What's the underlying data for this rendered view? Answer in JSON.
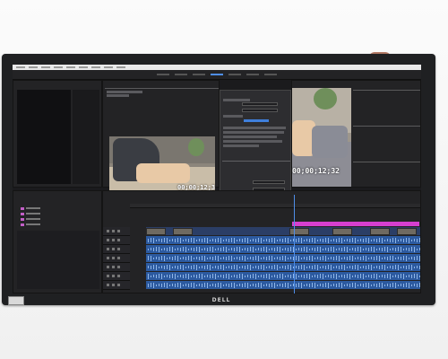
{
  "app": {
    "menu_items": [
      "",
      "",
      "",
      "",
      "",
      "",
      "",
      "",
      ""
    ],
    "workspace_tabs": [
      "",
      "",
      "",
      "",
      "",
      "",
      ""
    ],
    "active_workspace_index": 3
  },
  "source_monitor": {
    "timecode": "00;00;12;32"
  },
  "program_monitor": {
    "timecode": "00;00;12;32"
  },
  "export_dialog": {
    "title": "",
    "cancel_label": "",
    "queue_label": "",
    "export_label": ""
  },
  "timeline": {
    "playhead_fraction": 0.54
  },
  "monitor_brand": "DELL",
  "colors": {
    "accent": "#4f8ee8",
    "timeline_audio": "#2c5aa0",
    "work_area_bar": "#d63fcf",
    "media_bin_icon": "#c25fc6"
  },
  "icons": [
    "folder-icon",
    "play-icon",
    "settings-icon"
  ]
}
